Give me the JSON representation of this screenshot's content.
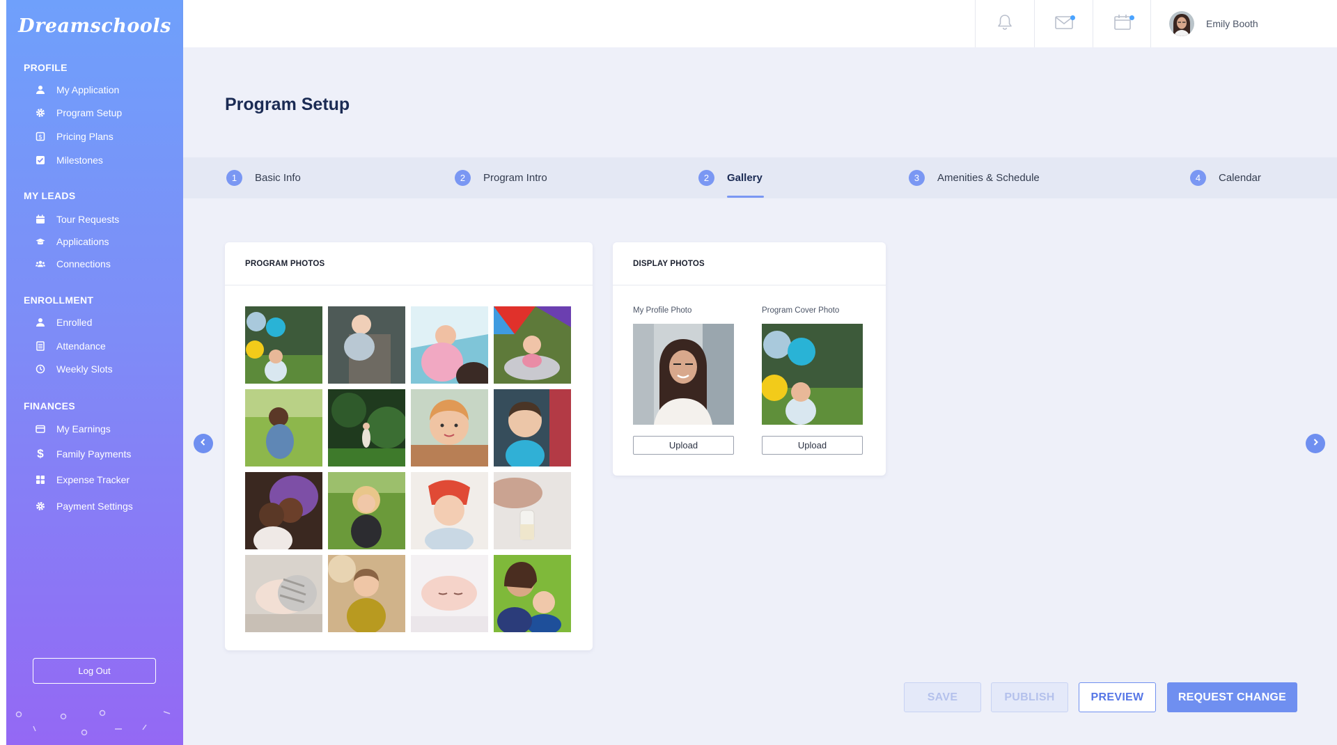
{
  "brand": "Dreamschools",
  "sidebar": {
    "sections": [
      {
        "title": "PROFILE",
        "items": [
          {
            "label": "My Application",
            "icon": "user-icon"
          },
          {
            "label": "Program Setup",
            "icon": "gear-icon"
          },
          {
            "label": "Pricing Plans",
            "icon": "dollar-square-icon"
          },
          {
            "label": "Milestones",
            "icon": "checkbox-icon"
          }
        ]
      },
      {
        "title": "MY LEADS",
        "items": [
          {
            "label": "Tour Requests",
            "icon": "calendar-icon"
          },
          {
            "label": "Applications",
            "icon": "graduation-cap-icon"
          },
          {
            "label": "Connections",
            "icon": "users-icon"
          }
        ]
      },
      {
        "title": "ENROLLMENT",
        "items": [
          {
            "label": "Enrolled",
            "icon": "user-icon"
          },
          {
            "label": "Attendance",
            "icon": "list-icon"
          },
          {
            "label": "Weekly Slots",
            "icon": "clock-icon"
          }
        ]
      },
      {
        "title": "FINANCES",
        "items": [
          {
            "label": "My Earnings",
            "icon": "wallet-icon"
          },
          {
            "label": "Family Payments",
            "icon": "dollar-icon"
          },
          {
            "label": "Expense Tracker",
            "icon": "grid-icon"
          },
          {
            "label": "Payment Settings",
            "icon": "gear-icon"
          }
        ]
      }
    ],
    "logout_label": "Log Out"
  },
  "topbar": {
    "icons": [
      "bell-icon",
      "mail-icon",
      "calendar-icon"
    ],
    "user_name": "Emily Booth"
  },
  "main": {
    "page_title": "Program Setup",
    "tabs": [
      {
        "num": "1",
        "label": "Basic Info"
      },
      {
        "num": "2",
        "label": "Program Intro"
      },
      {
        "num": "2",
        "label": "Gallery",
        "active": true
      },
      {
        "num": "3",
        "label": "Amenities & Schedule"
      },
      {
        "num": "4",
        "label": "Calendar"
      }
    ],
    "program_photos": {
      "title": "PROGRAM PHOTOS",
      "count": 16
    },
    "display_photos": {
      "title": "DISPLAY PHOTOS",
      "profile_label": "My Profile Photo",
      "cover_label": "Program Cover Photo",
      "upload_label": "Upload"
    },
    "actions": {
      "save": "SAVE",
      "publish": "PUBLISH",
      "preview": "PREVIEW",
      "request_change": "REQUEST CHANGE"
    }
  },
  "colors": {
    "accent": "#6f8ff0",
    "sidebar_top": "#6fa0fb",
    "sidebar_bottom": "#9468f4",
    "background": "#eef0f9"
  }
}
